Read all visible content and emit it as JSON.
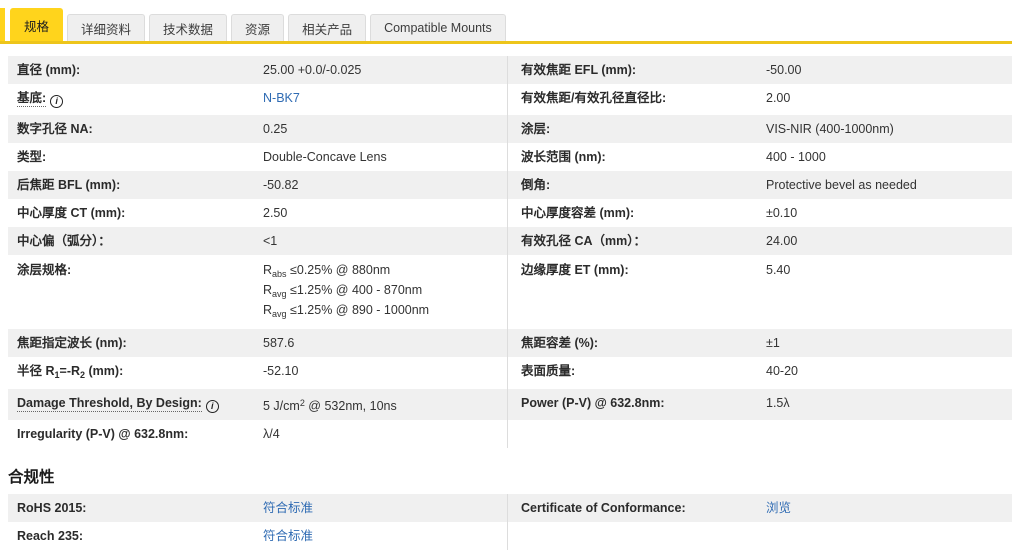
{
  "colors": {
    "brand_yellow": "#FFD41C",
    "tab_underline": "#EDC51B",
    "link_blue": "#2F6BB3",
    "row_stripe": "#F0F0F0"
  },
  "tabs": [
    {
      "name": "tab-specifications",
      "label": "规格",
      "active": true
    },
    {
      "name": "tab-details",
      "label": "详细资料",
      "active": false
    },
    {
      "name": "tab-technical-data",
      "label": "技术数据",
      "active": false
    },
    {
      "name": "tab-resources",
      "label": "资源",
      "active": false
    },
    {
      "name": "tab-related-products",
      "label": "相关产品",
      "active": false
    },
    {
      "name": "tab-compatible-mounts",
      "label": "Compatible Mounts",
      "active": false
    }
  ],
  "specs": {
    "rows": [
      {
        "l1": "直径 (mm):",
        "v1": "25.00 +0.0/-0.025",
        "l2": "有效焦距 EFL (mm):",
        "v2": "-50.00"
      },
      {
        "l1": "基底:",
        "l1_info": true,
        "v1": "N-BK7",
        "v1_link": true,
        "l2": "有效焦距/有效孔径直径比:",
        "v2": "2.00"
      },
      {
        "l1": "数字孔径 NA:",
        "v1": "0.25",
        "l2": "涂层:",
        "v2": "VIS-NIR (400-1000nm)"
      },
      {
        "l1": "类型:",
        "v1": "Double-Concave Lens",
        "l2": "波长范围 (nm):",
        "v2": "400 - 1000"
      },
      {
        "l1": "后焦距 BFL (mm):",
        "v1": "-50.82",
        "l2": "倒角:",
        "v2": "Protective bevel as needed"
      },
      {
        "l1": "中心厚度 CT (mm):",
        "v1": "2.50",
        "l2": "中心厚度容差 (mm):",
        "v2": "±0.10"
      },
      {
        "l1": "中心偏（弧分）：",
        "v1": "<1",
        "l2": "有效孔径 CA（mm）：",
        "v2": "24.00"
      },
      {
        "l1": "涂层规格:",
        "multiline": true,
        "v1_html": "R<sub>abs</sub> ≤0.25% @ 880nm<br>R<sub>avg</sub> ≤1.25% @ 400 - 870nm<br>R<sub>avg</sub> ≤1.25% @ 890 - 1000nm",
        "l2": "边缘厚度 ET (mm):",
        "v2": "5.40"
      },
      {
        "l1": "焦距指定波长 (nm):",
        "v1": "587.6",
        "l2": "焦距容差 (%):",
        "v2": "±1"
      },
      {
        "l1_html": "半径 R<sub>1</sub>=-R<sub>2</sub> (mm):",
        "v1": "-52.10",
        "l2": "表面质量:",
        "v2": "40-20"
      },
      {
        "l1": "Damage Threshold, By Design:",
        "l1_info": true,
        "v1_html": "5 J/cm<sup>2</sup> @ 532nm, 10ns",
        "l2": "Power (P-V) @ 632.8nm:",
        "v2": "1.5λ"
      },
      {
        "l1": "Irregularity (P-V) @ 632.8nm:",
        "v1": "λ/4",
        "l2": "",
        "v2": ""
      }
    ]
  },
  "compliance": {
    "heading": "合规性",
    "rows": [
      {
        "l1": "RoHS 2015:",
        "v1": "符合标准",
        "v1_link": true,
        "l2": "Certificate of Conformance:",
        "v2": "浏览",
        "v2_link": true
      },
      {
        "l1": "Reach 235:",
        "v1": "符合标准",
        "v1_link": true,
        "l2": "",
        "v2": ""
      }
    ]
  }
}
